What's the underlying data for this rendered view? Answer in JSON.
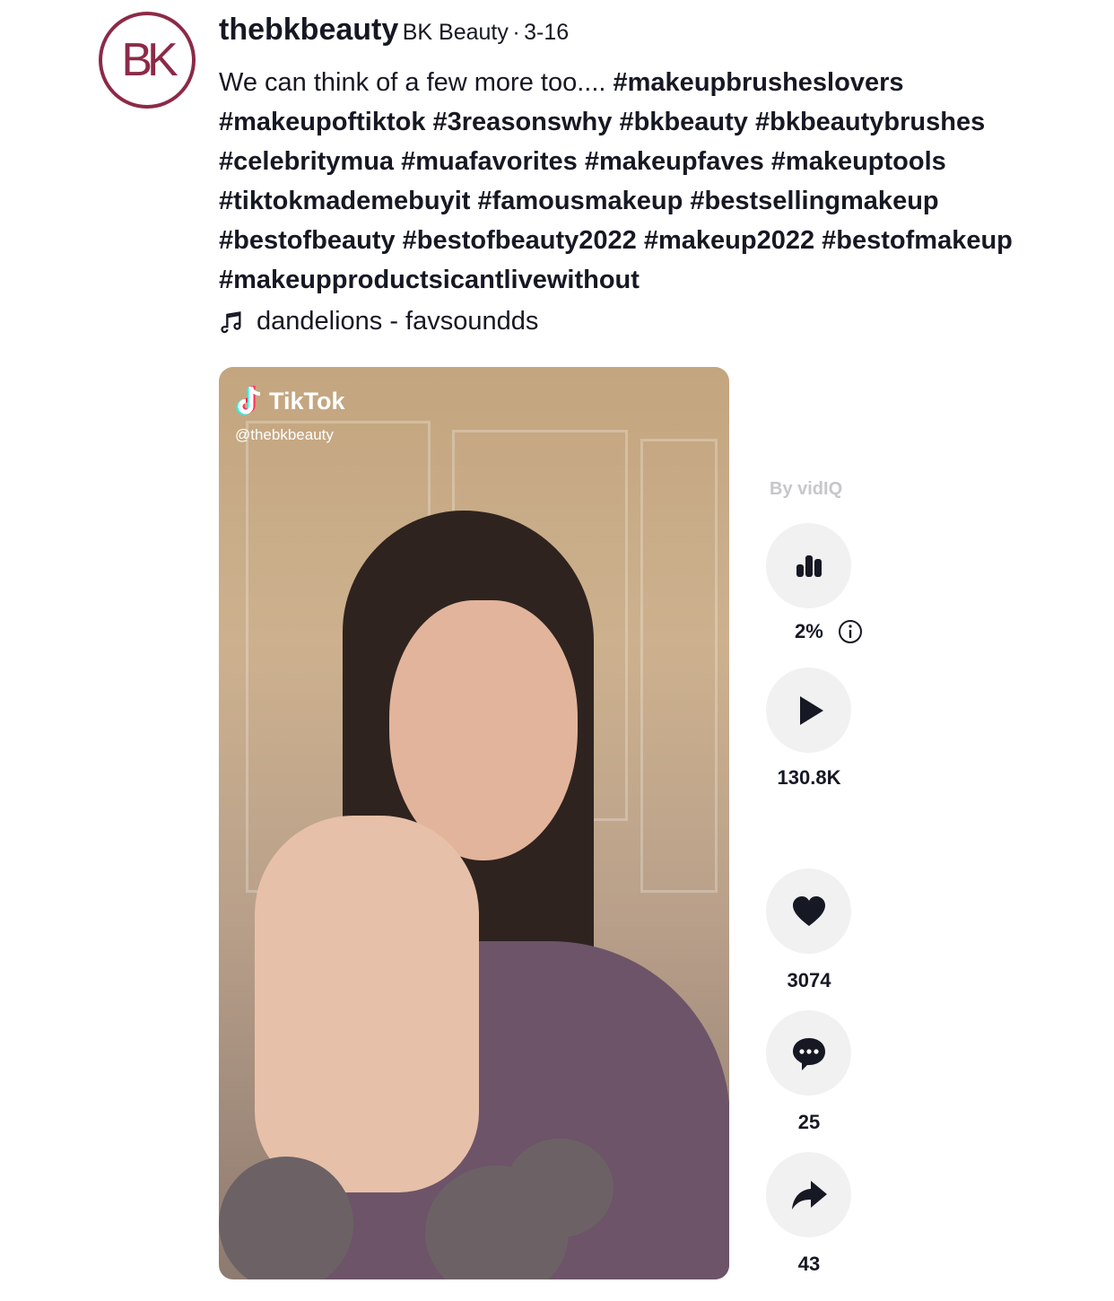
{
  "profile": {
    "avatar_text": "BK",
    "username": "thebkbeauty",
    "nickname": "BK Beauty",
    "separator": "·",
    "date": "3-16"
  },
  "caption": {
    "text": "We can think of a few more too....",
    "hashtags": [
      "#makeupbrusheslovers",
      "#makeupoftiktok",
      "#3reasonswhy",
      "#bkbeauty",
      "#bkbeautybrushes",
      "#celebritymua",
      "#muafavorites",
      "#makeupfaves",
      "#makeuptools",
      "#tiktokmademebuyit",
      "#famousmakeup",
      "#bestsellingmakeup",
      "#bestofbeauty",
      "#bestofbeauty2022",
      "#makeup2022",
      "#bestofmakeup",
      "#makeupproductsicantlivewithout"
    ]
  },
  "music": {
    "icon": "music-note-icon",
    "label": "dandelions - favsoundds"
  },
  "video": {
    "watermark_brand": "TikTok",
    "watermark_handle": "@thebkbeauty"
  },
  "sidebar": {
    "vidiq_label": "By vidIQ",
    "engagement_rate": "2%",
    "plays": "130.8K",
    "likes": "3074",
    "comments": "25",
    "shares": "43"
  },
  "colors": {
    "brand": "#8c2a47",
    "text": "#161823",
    "button_bg": "#f1f1f2",
    "muted": "#c6c7cb"
  }
}
